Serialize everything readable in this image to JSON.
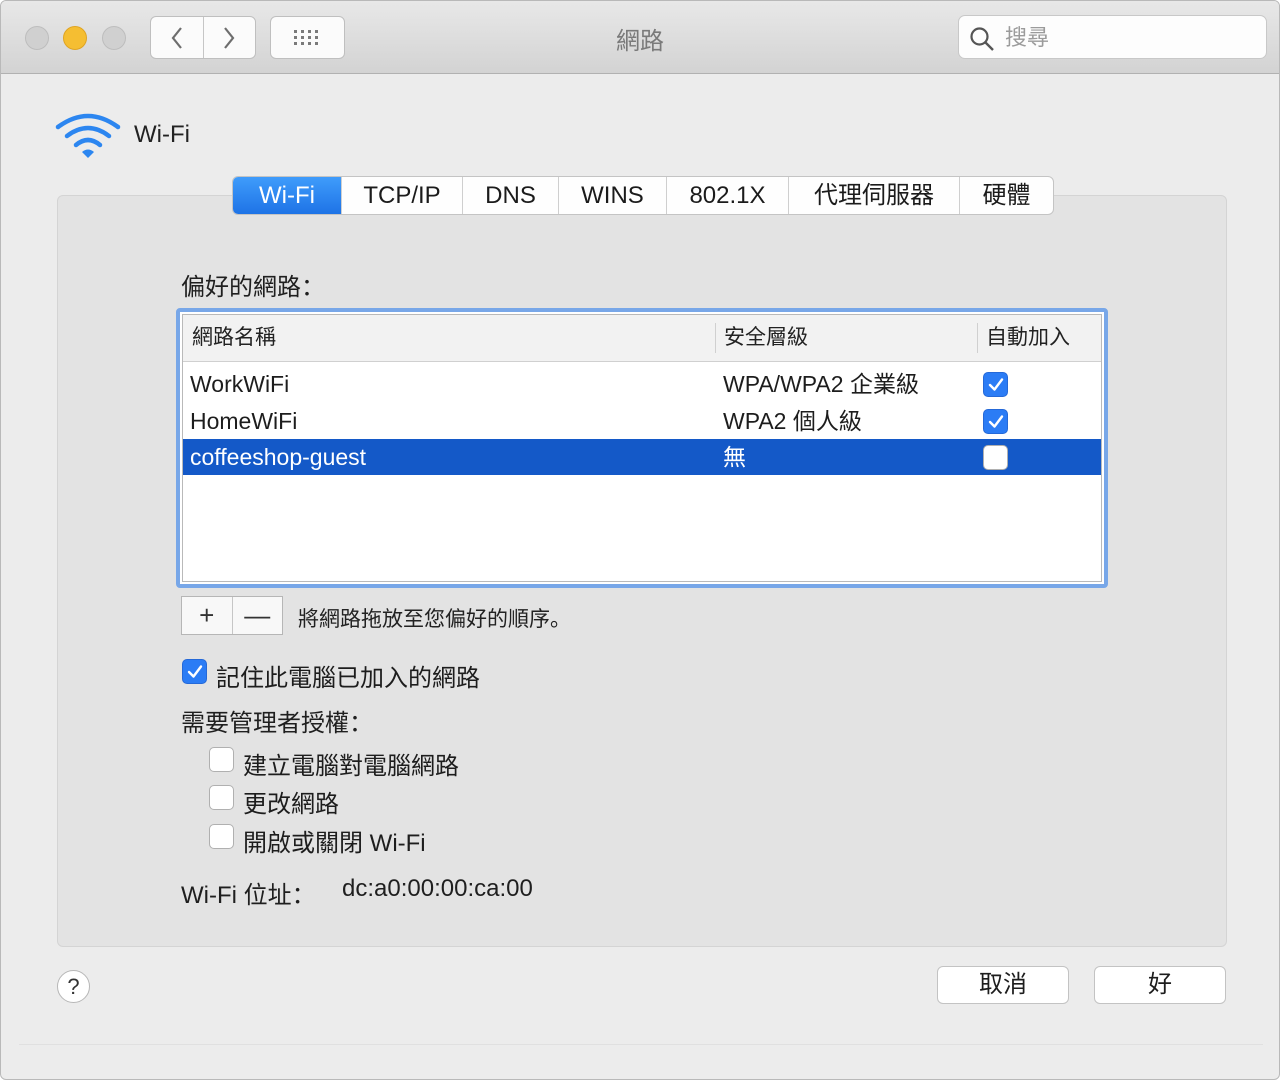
{
  "window": {
    "title": "網路",
    "search_placeholder": "搜尋"
  },
  "interface": {
    "name": "Wi-Fi",
    "icon": "wifi-icon"
  },
  "tabs": [
    {
      "label": "Wi-Fi",
      "active": true
    },
    {
      "label": "TCP/IP",
      "active": false
    },
    {
      "label": "DNS",
      "active": false
    },
    {
      "label": "WINS",
      "active": false
    },
    {
      "label": "802.1X",
      "active": false
    },
    {
      "label": "代理伺服器",
      "active": false
    },
    {
      "label": "硬體",
      "active": false
    }
  ],
  "preferred": {
    "label": "偏好的網路：",
    "columns": [
      "網路名稱",
      "安全層級",
      "自動加入"
    ],
    "rows": [
      {
        "name": "WorkWiFi",
        "security": "WPA/WPA2 企業級",
        "auto_join": true,
        "selected": false
      },
      {
        "name": "HomeWiFi",
        "security": "WPA2 個人級",
        "auto_join": true,
        "selected": false
      },
      {
        "name": "coffeeshop-guest",
        "security": "無",
        "auto_join": false,
        "selected": true
      }
    ],
    "add_label": "+",
    "remove_label": "—",
    "hint": "將網路拖放至您偏好的順序。"
  },
  "options": {
    "remember_label": "記住此電腦已加入的網路",
    "remember_checked": true,
    "admin_label": "需要管理者授權：",
    "admin_items": [
      {
        "label": "建立電腦對電腦網路",
        "checked": false
      },
      {
        "label": "更改網路",
        "checked": false
      },
      {
        "label": "開啟或關閉 Wi-Fi",
        "checked": false
      }
    ]
  },
  "address": {
    "label": "Wi-Fi 位址：",
    "value": "dc:a0:00:00:ca:00"
  },
  "footer": {
    "help_label": "?",
    "cancel_label": "取消",
    "ok_label": "好"
  },
  "colors": {
    "accent": "#1e73e6",
    "selection": "#1459c8",
    "checkbox_on": "#2b7cf5",
    "minimize": "#f5be32"
  }
}
